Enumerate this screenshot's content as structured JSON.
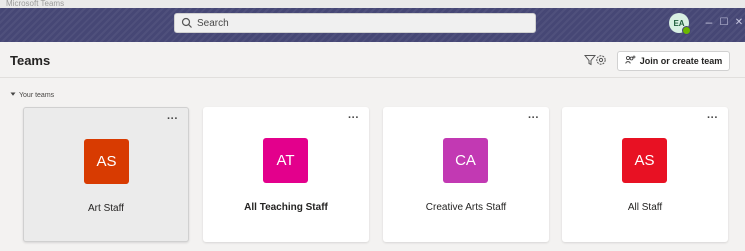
{
  "window": {
    "strip_title": "Microsoft Teams",
    "minimize_glyph": "–",
    "maximize_glyph": "☐",
    "close_glyph": "✕"
  },
  "search": {
    "placeholder": "Search",
    "icon": "search-icon"
  },
  "user": {
    "initials": "EA",
    "status_color": "#6bb700"
  },
  "header": {
    "title": "Teams",
    "filter_icon": "filter-icon",
    "settings_icon": "gear-icon",
    "join_label": "Join or create team",
    "join_icon": "people-add-icon"
  },
  "section": {
    "label": "Your teams"
  },
  "teams": [
    {
      "initials": "AS",
      "name": "Art Staff",
      "color": "#d83b01",
      "selected": true,
      "bold": false
    },
    {
      "initials": "AT",
      "name": "All Teaching Staff",
      "color": "#e3008c",
      "selected": false,
      "bold": true
    },
    {
      "initials": "CA",
      "name": "Creative Arts Staff",
      "color": "#c239b3",
      "selected": false,
      "bold": false
    },
    {
      "initials": "AS",
      "name": "All Staff",
      "color": "#e81123",
      "selected": false,
      "bold": false
    }
  ],
  "more_glyph": "···",
  "colors": {
    "titlebar": "#464775",
    "background": "#f3f2f1"
  }
}
